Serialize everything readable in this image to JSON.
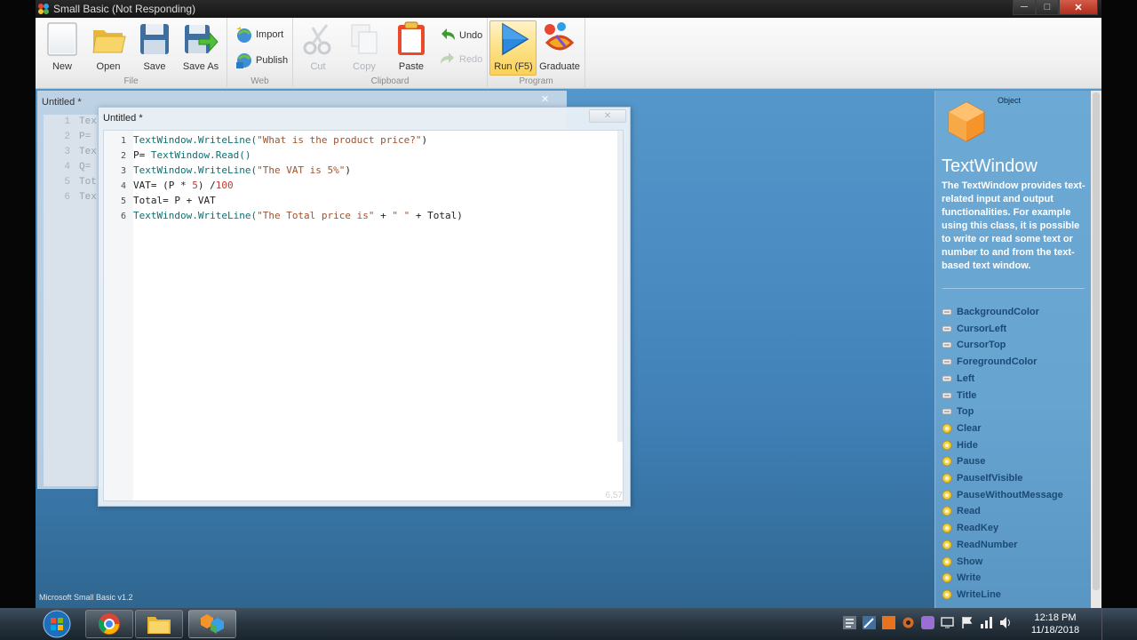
{
  "window": {
    "title": "Small Basic (Not Responding)",
    "controls": [
      "─",
      "□",
      "✕"
    ]
  },
  "ribbon": {
    "groups": {
      "file": {
        "label": "File",
        "buttons": {
          "new": "New",
          "open": "Open",
          "save": "Save",
          "save_as": "Save As"
        }
      },
      "web": {
        "label": "Web",
        "buttons": {
          "import": "Import",
          "publish": "Publish"
        }
      },
      "clipboard": {
        "label": "Clipboard",
        "buttons": {
          "cut": "Cut",
          "copy": "Copy",
          "paste": "Paste",
          "undo": "Undo",
          "redo": "Redo"
        }
      },
      "program": {
        "label": "Program",
        "buttons": {
          "run": "Run (F5)",
          "graduate": "Graduate"
        }
      }
    }
  },
  "back_editor": {
    "title": "Untitled *",
    "lines": [
      {
        "n": "1",
        "text": "Tex"
      },
      {
        "n": "2",
        "text": "P="
      },
      {
        "n": "3",
        "text": "Tex"
      },
      {
        "n": "4",
        "text": "Q="
      },
      {
        "n": "5",
        "text": "Tot"
      },
      {
        "n": "6",
        "text": "Tex"
      }
    ]
  },
  "editor": {
    "title": "Untitled *",
    "close": "✕",
    "cursor_position": "6,57",
    "lines": [
      {
        "n": "1",
        "tokens": [
          {
            "t": "TextWindow.WriteLine(",
            "c": "tk-ident"
          },
          {
            "t": "\"What is the product price?\"",
            "c": "tk-str"
          },
          {
            "t": ")",
            "c": "tk-plain"
          }
        ]
      },
      {
        "n": "2",
        "tokens": [
          {
            "t": "P= ",
            "c": "tk-plain"
          },
          {
            "t": "TextWindow.Read()",
            "c": "tk-ident"
          }
        ]
      },
      {
        "n": "3",
        "tokens": [
          {
            "t": "TextWindow.WriteLine(",
            "c": "tk-ident"
          },
          {
            "t": "\"The VAT is 5%\"",
            "c": "tk-str"
          },
          {
            "t": ")",
            "c": "tk-plain"
          }
        ]
      },
      {
        "n": "4",
        "tokens": [
          {
            "t": "VAT= (P * ",
            "c": "tk-plain"
          },
          {
            "t": "5",
            "c": "tk-num"
          },
          {
            "t": ") /",
            "c": "tk-plain"
          },
          {
            "t": "100",
            "c": "tk-num"
          }
        ]
      },
      {
        "n": "5",
        "tokens": [
          {
            "t": "Total= P + VAT",
            "c": "tk-plain"
          }
        ]
      },
      {
        "n": "6",
        "tokens": [
          {
            "t": "TextWindow.WriteLine(",
            "c": "tk-ident"
          },
          {
            "t": "\"The Total price is\"",
            "c": "tk-str"
          },
          {
            "t": " + ",
            "c": "tk-plain"
          },
          {
            "t": "\" \"",
            "c": "tk-str"
          },
          {
            "t": " + Total)",
            "c": "tk-plain"
          }
        ]
      }
    ]
  },
  "help": {
    "kind": "Object",
    "name": "TextWindow",
    "description": "The TextWindow provides text-related input and output functionalities.  For example using this class, it is possible to write or read some text or number to and from the text-based text window.",
    "properties": [
      "BackgroundColor",
      "CursorLeft",
      "CursorTop",
      "ForegroundColor",
      "Left",
      "Title",
      "Top"
    ],
    "methods": [
      "Clear",
      "Hide",
      "Pause",
      "PauseIfVisible",
      "PauseWithoutMessage",
      "Read",
      "ReadKey",
      "ReadNumber",
      "Show",
      "Write",
      "WriteLine"
    ]
  },
  "status": {
    "version": "Microsoft Small Basic v1.2"
  },
  "taskbar": {
    "apps": [
      "windows-explorer",
      "chrome",
      "file-explorer",
      "small-basic"
    ],
    "clock": {
      "time": "12:18 PM",
      "date": "11/18/2018"
    }
  },
  "colors": {
    "accent": "#fbd15a",
    "identifier": "#0f6e6e",
    "string": "#a0522d",
    "number": "#c0392b",
    "member_text": "#1b4a75"
  }
}
